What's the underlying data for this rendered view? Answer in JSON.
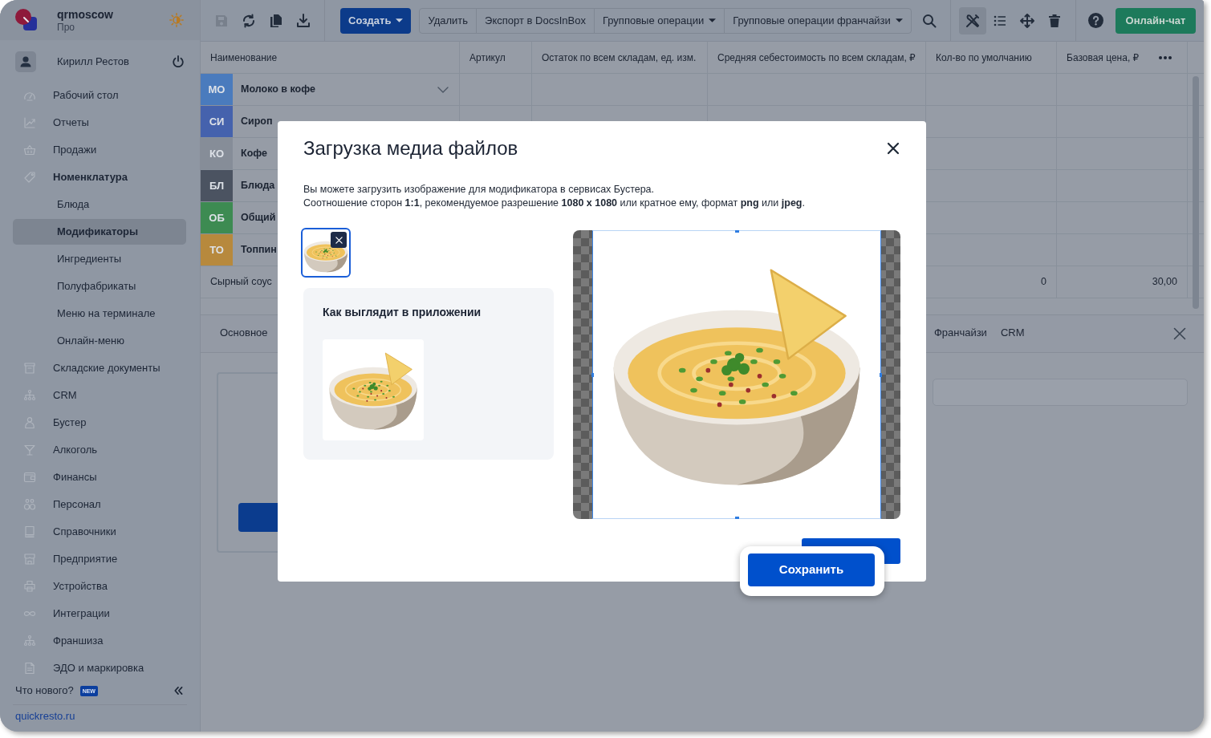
{
  "sidebar": {
    "account": {
      "name": "qrmoscow",
      "plan": "Про"
    },
    "user": {
      "name": "Кирилл Рестов"
    },
    "items": [
      {
        "label": "Рабочий стол",
        "selected": false,
        "expanded": false
      },
      {
        "label": "Отчеты",
        "selected": false,
        "expanded": false
      },
      {
        "label": "Продажи",
        "selected": false,
        "expanded": false
      },
      {
        "label": "Номенклатура",
        "selected": false,
        "expanded": true,
        "children": [
          {
            "label": "Блюда",
            "selected": false
          },
          {
            "label": "Модификаторы",
            "selected": true
          },
          {
            "label": "Ингредиенты",
            "selected": false
          },
          {
            "label": "Полуфабрикаты",
            "selected": false
          },
          {
            "label": "Меню на терминале",
            "selected": false
          },
          {
            "label": "Онлайн-меню",
            "selected": false
          }
        ]
      },
      {
        "label": "Складские документы",
        "selected": false,
        "expanded": false
      },
      {
        "label": "CRM",
        "selected": false,
        "expanded": false
      },
      {
        "label": "Бустер",
        "selected": false,
        "expanded": false
      },
      {
        "label": "Алкоголь",
        "selected": false,
        "expanded": false
      },
      {
        "label": "Финансы",
        "selected": false,
        "expanded": false
      },
      {
        "label": "Персонал",
        "selected": false,
        "expanded": false
      },
      {
        "label": "Справочники",
        "selected": false,
        "expanded": false
      },
      {
        "label": "Предприятие",
        "selected": false,
        "expanded": false
      },
      {
        "label": "Устройства",
        "selected": false,
        "expanded": false
      },
      {
        "label": "Интеграции",
        "selected": false,
        "expanded": false
      },
      {
        "label": "Франшиза",
        "selected": false,
        "expanded": false
      },
      {
        "label": "ЭДО и маркировка",
        "selected": false,
        "expanded": false
      }
    ],
    "whats_new": {
      "label": "Что нового?",
      "badge": "NEW"
    },
    "site_link": "quickresto.ru"
  },
  "toolbar": {
    "icon_buttons": [
      {
        "disabled": true
      },
      {
        "disabled": false
      },
      {
        "disabled": false
      },
      {
        "disabled": false
      }
    ],
    "create_button": {
      "label": "Создать",
      "dropdown": true
    },
    "actions": [
      {
        "label": "Удалить",
        "dropdown": false
      },
      {
        "label": "Экспорт в DocsInBox",
        "dropdown": false
      },
      {
        "label": "Групповые операции",
        "dropdown": true
      },
      {
        "label": "Групповые операции франчайзи",
        "dropdown": true
      }
    ],
    "view_buttons": [
      {
        "selected": true
      },
      {
        "selected": false
      },
      {
        "selected": false
      },
      {
        "selected": false
      }
    ],
    "chat_button": "Онлайн-чат"
  },
  "table": {
    "columns": [
      "Наименование",
      "Артикул",
      "Остаток по всем складам, ед. изм.",
      "Средняя себестоимость по всем складам, ₽",
      "Кол-во по умолчанию",
      "Базовая цена, ₽"
    ],
    "groups": [
      {
        "tag": "МО",
        "name": "Молоко в кофе",
        "color": "#4a7bbd",
        "expanded": false
      },
      {
        "tag": "СИ",
        "name": "Сироп",
        "color": "#4562ad"
      },
      {
        "tag": "КО",
        "name": "Кофе",
        "color": "#868d98"
      },
      {
        "tag": "БЛ",
        "name": "Блюда",
        "color": "#4b5361"
      },
      {
        "tag": "ОБ",
        "name": "Общий",
        "color": "#3d8b52"
      },
      {
        "tag": "ТО",
        "name": "Топпин",
        "color": "#b7893d"
      }
    ],
    "rows": [
      {
        "name": "Сырный соус",
        "default_qty": "0",
        "base_price": "30,00"
      }
    ]
  },
  "detail_panel": {
    "tabs": [
      {
        "label": "Основное",
        "selected": false
      },
      {
        "label": "Франчайзи",
        "selected": false
      },
      {
        "label": "CRM",
        "selected": false
      }
    ]
  },
  "modal": {
    "title": "Загрузка медиа файлов",
    "description": [
      "Вы можете загрузить изображение для модификатора в сервисах Бустера.",
      "Соотношение сторон **1:1**, рекомендуемое разрешение **1080 x 1080** или кратное ему, формат **png** или **jpeg**."
    ],
    "images": [
      {
        "selected": true
      }
    ],
    "preview": {
      "title": "Как выглядит в приложении"
    },
    "save_button": "Сохранить"
  }
}
